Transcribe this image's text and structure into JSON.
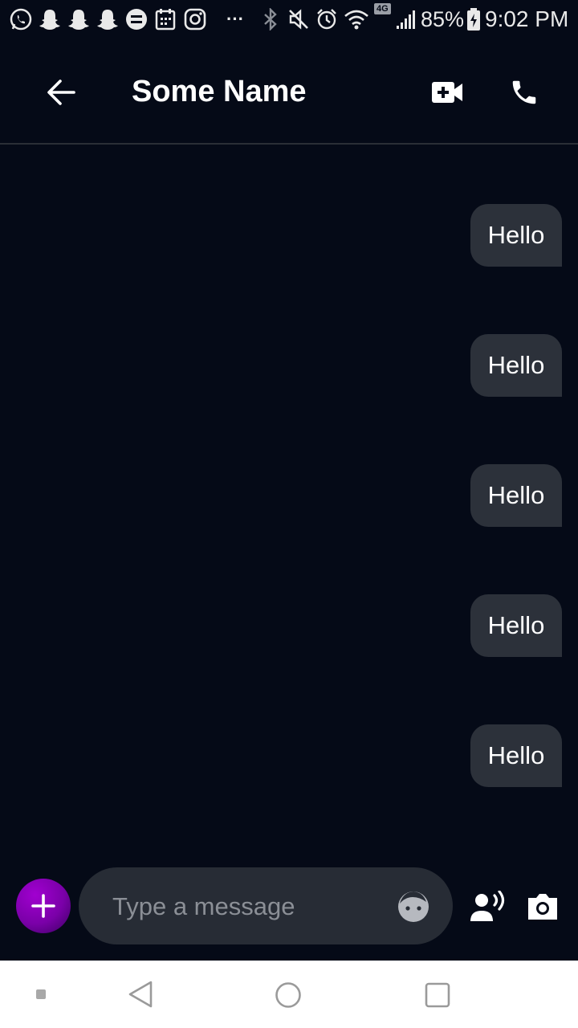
{
  "status_bar": {
    "notification_icons": [
      "whatsapp-icon",
      "snapchat-icon",
      "snapchat-icon",
      "snapchat-icon",
      "messenger-app-icon",
      "calendar-icon",
      "instagram-icon",
      "more-dots-icon"
    ],
    "system_icons": [
      "bluetooth-icon",
      "mute-icon",
      "alarm-icon",
      "wifi-icon",
      "4g-icon",
      "signal-icon",
      "battery-charging-icon"
    ],
    "more_label": "···",
    "network_label": "4G",
    "battery": "85%",
    "time": "9:02 PM"
  },
  "header": {
    "title": "Some Name"
  },
  "messages": [
    {
      "text": "Hello",
      "sender": "me"
    },
    {
      "text": "Hello",
      "sender": "me"
    },
    {
      "text": "Hello",
      "sender": "me"
    },
    {
      "text": "Hello",
      "sender": "me"
    },
    {
      "text": "Hello",
      "sender": "me"
    }
  ],
  "composer": {
    "placeholder": "Type a message",
    "value": ""
  },
  "colors": {
    "background": "#050a17",
    "bubble": "#2c313a",
    "accent": "#8a00c0",
    "input": "#272c35"
  }
}
